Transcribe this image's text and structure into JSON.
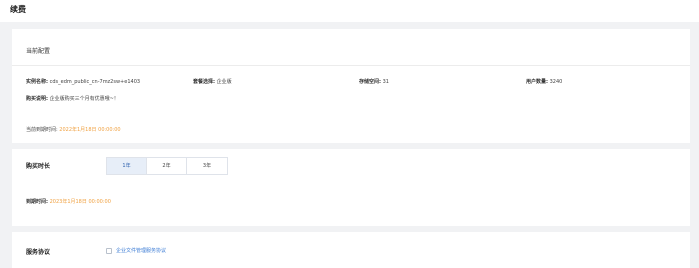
{
  "page": {
    "title": "续费"
  },
  "current_config": {
    "section_title": "当前配置",
    "instance_name_label": "实例名称:",
    "instance_name_value": "cds_edm_public_cn-7mz2sw+e1403",
    "package_label": "套餐选择:",
    "package_value": "企业版",
    "storage_label": "存储空间:",
    "storage_value": "31",
    "users_label": "用户数量:",
    "users_value": "3240",
    "purchase_note_label": "购买说明:",
    "purchase_note_value": "企业版购买三个月有优惠哦~！",
    "expire_label": "当前到期时间:",
    "expire_value": "2022年1月18日 00:00:00"
  },
  "purchase": {
    "duration_label": "购买时长",
    "options": [
      "1年",
      "2年",
      "3年"
    ],
    "selected": "1年",
    "expire_label": "到期时间:",
    "expire_value": "2023年1月18日 00:00:00"
  },
  "agreement": {
    "label": "服务协议",
    "link_text": "企业文件管理服务协议"
  },
  "colors": {
    "accent_orange": "#f0a141",
    "link_blue": "#3a7bd5",
    "selected_bg": "#e7eef8"
  }
}
